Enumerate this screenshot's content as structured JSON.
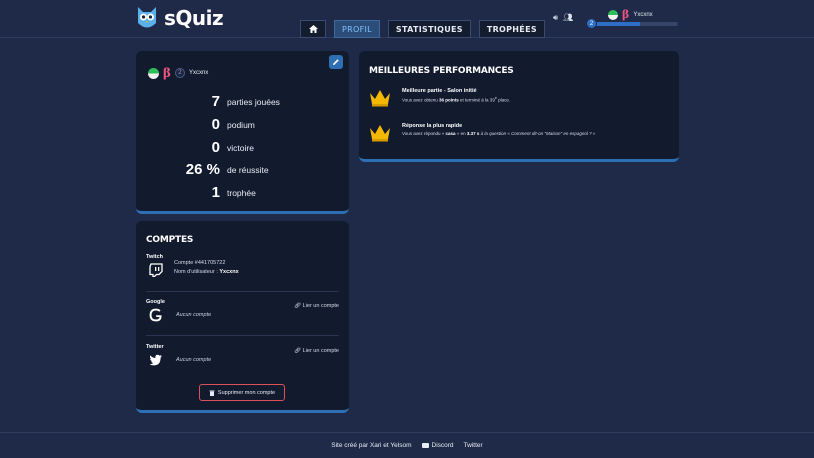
{
  "header": {
    "logo_text": "sQuiz",
    "tabs": [
      {
        "label": "",
        "icon": "home-icon"
      },
      {
        "label": "PROFIL",
        "active": true
      },
      {
        "label": "STATISTIQUES"
      },
      {
        "label": "TROPHÉES"
      }
    ],
    "username": "Yxcxnx",
    "beta": "β",
    "level": "2",
    "xp_progress": 0.55
  },
  "profile": {
    "username": "Yxcxnx",
    "beta": "β",
    "level": "2",
    "stats": [
      {
        "value": "7",
        "label": "parties jouées"
      },
      {
        "value": "0",
        "label": "podium"
      },
      {
        "value": "0",
        "label": "victoire"
      },
      {
        "value": "26 %",
        "label": "de réussite"
      },
      {
        "value": "1",
        "label": "trophée"
      }
    ]
  },
  "performances": {
    "title": "MEILLEURES PERFORMANCES",
    "items": [
      {
        "title": "Meilleure partie - Salon initié",
        "desc_pre": "Vous avez obtenu ",
        "desc_b1": "36 points",
        "desc_mid": " et terminé à la 39",
        "desc_sup": "e",
        "desc_post": " place."
      },
      {
        "title": "Réponse la plus rapide",
        "desc_pre": "Vous avez répondu « ",
        "desc_b1": "casa",
        "desc_mid": " » en ",
        "desc_b2": "3.37 s",
        "desc_post": " à la question « Comment dit-on \"Maison\" en espagnol ? »"
      }
    ]
  },
  "accounts": {
    "title": "COMPTES",
    "twitch": {
      "name": "Twitch",
      "account_line": "Compte #441705722",
      "username_label": "Nom d'utilisateur : ",
      "username": "Yxcxnx"
    },
    "google": {
      "name": "Google",
      "none": "Aucun compte",
      "link": "Lier un compte"
    },
    "twitter": {
      "name": "Twitter",
      "none": "Aucun compte",
      "link": "Lier un compte"
    },
    "delete_label": "Supprimer mon compte"
  },
  "footer": {
    "credit": "Site créé par Xari et Yelsom",
    "discord": "Discord",
    "twitter": "Twitter"
  },
  "colors": {
    "background": "#1f2a48",
    "card": "#121a2e",
    "accent": "#2e6fb3",
    "danger": "#e0505c",
    "crown": "#f5b800"
  }
}
